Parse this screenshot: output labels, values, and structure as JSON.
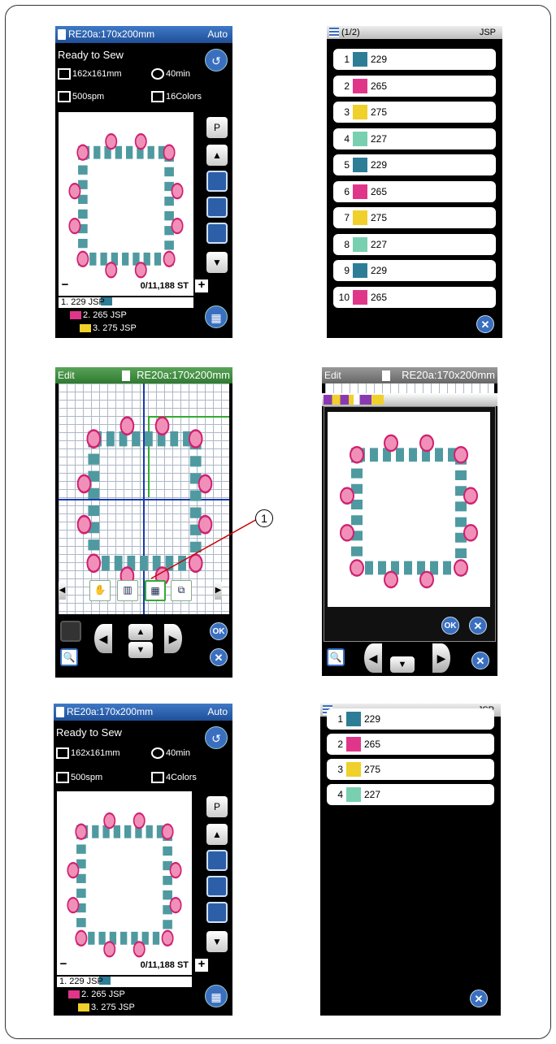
{
  "sew_screen": {
    "title": "RE20a:170x200mm",
    "auto_label": "Auto",
    "status": "Ready to Sew",
    "size": "162x161mm",
    "time": "40min",
    "speed": "500spm",
    "stitch_count": "0/11,188 ST"
  },
  "sew_before": {
    "colors_label": "16Colors",
    "thread_list": [
      "1.  229 JSP",
      "2.  265 JSP",
      "3.  275 JSP"
    ]
  },
  "sew_after": {
    "colors_label": "4Colors",
    "thread_list": [
      "1.  229 JSP",
      "2.  265 JSP",
      "3.  275 JSP"
    ]
  },
  "color_list_before": {
    "page": "(1/2)",
    "brand": "JSP",
    "rows": [
      {
        "num": "1",
        "code": "229",
        "color": "#2e7d96"
      },
      {
        "num": "2",
        "code": "265",
        "color": "#e0368a"
      },
      {
        "num": "3",
        "code": "275",
        "color": "#f0d02a"
      },
      {
        "num": "4",
        "code": "227",
        "color": "#78d0b0"
      },
      {
        "num": "5",
        "code": "229",
        "color": "#2e7d96"
      },
      {
        "num": "6",
        "code": "265",
        "color": "#e0368a"
      },
      {
        "num": "7",
        "code": "275",
        "color": "#f0d02a"
      },
      {
        "num": "8",
        "code": "227",
        "color": "#78d0b0"
      },
      {
        "num": "9",
        "code": "229",
        "color": "#2e7d96"
      },
      {
        "num": "10",
        "code": "265",
        "color": "#e0368a"
      }
    ]
  },
  "color_list_after": {
    "brand": "JSP",
    "rows": [
      {
        "num": "1",
        "code": "229",
        "color": "#2e7d96"
      },
      {
        "num": "2",
        "code": "265",
        "color": "#e0368a"
      },
      {
        "num": "3",
        "code": "275",
        "color": "#f0d02a"
      },
      {
        "num": "4",
        "code": "227",
        "color": "#78d0b0"
      }
    ]
  },
  "edit_screen": {
    "mode": "Edit",
    "title": "RE20a:170x200mm",
    "ok_label": "OK",
    "callout": "1"
  },
  "group_dialog": {
    "mode": "Edit",
    "title": "RE20a:170x200mm",
    "ok_label": "OK"
  },
  "colors": {
    "header_blue": "#2a5ea8",
    "edit_green": "#3f8f3f",
    "thread_teal": "#2e7d96",
    "thread_pink": "#e0368a",
    "thread_yellow": "#f0d02a",
    "thread_mint": "#78d0b0"
  }
}
